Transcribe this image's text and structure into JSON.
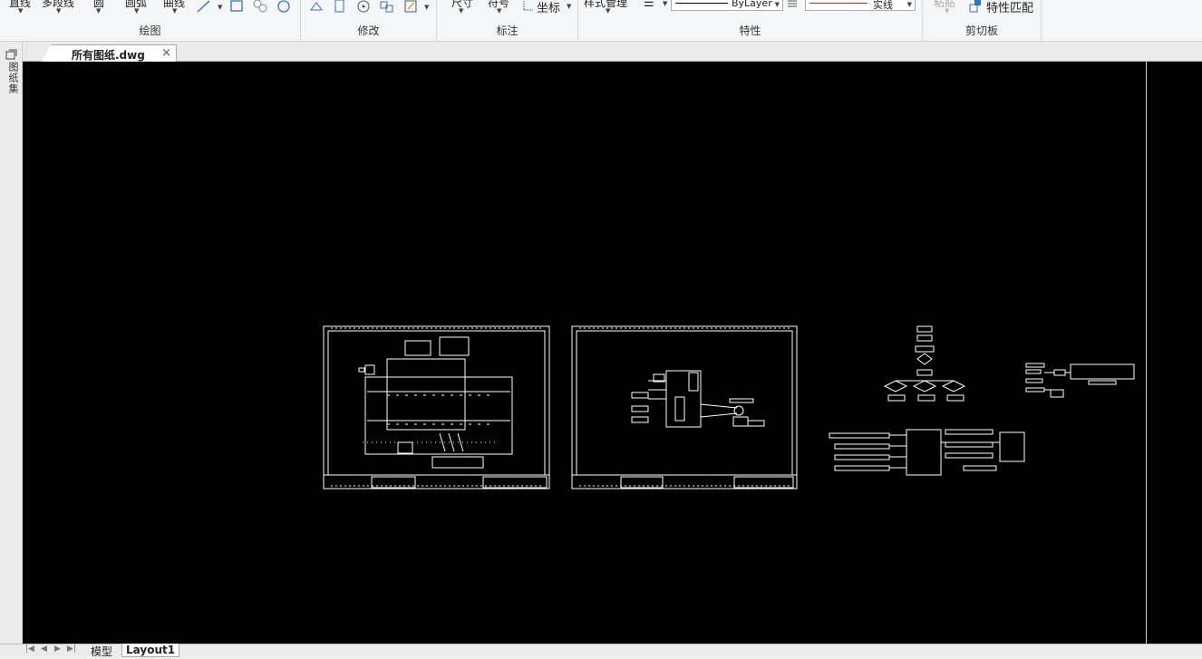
{
  "ribbon": {
    "draw": {
      "title": "绘图",
      "line": "直线",
      "polyline": "多段线",
      "circle": "圆",
      "arc": "圆弧",
      "curve": "曲线"
    },
    "modify": {
      "title": "修改"
    },
    "annotate": {
      "title": "标注",
      "dimension": "尺寸",
      "symbol": "符号",
      "coordinate": "坐标"
    },
    "properties": {
      "title": "特性",
      "style_manager": "样式管理",
      "color_value": "ByLayer",
      "linetype_value": "实线",
      "linetype_color": "#d22"
    },
    "clipboard": {
      "title": "剪切板",
      "paste": "粘贴",
      "match_properties": "特性匹配"
    }
  },
  "tabs": {
    "document": "所有图纸.dwg",
    "close": "×"
  },
  "leftstrip": {
    "label": "图纸集"
  },
  "layouts": {
    "model": "模型",
    "layout1": "Layout1",
    "active": "Layout1"
  },
  "icons": {
    "first": "first-page-icon",
    "prev": "prev-icon",
    "next": "next-icon",
    "last": "last-page-icon"
  },
  "canvas": {
    "background": "#000000",
    "stroke": "#ffffff"
  }
}
